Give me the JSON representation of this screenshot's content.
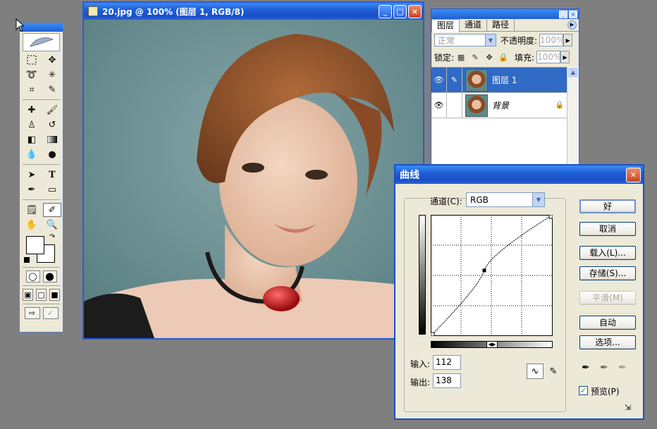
{
  "image_window": {
    "title": "20.jpg @ 100% (图层 1, RGB/8)",
    "buttons": [
      "_",
      "□",
      "×"
    ]
  },
  "layers_panel": {
    "tabs": [
      "图层",
      "通道",
      "路径"
    ],
    "blend_mode": "正常",
    "opacity_label": "不透明度:",
    "opacity_value": "100%",
    "lock_label": "锁定:",
    "fill_label": "填充:",
    "fill_value": "100%",
    "layers": [
      {
        "name": "图层 1",
        "selected": true
      },
      {
        "name": "背景",
        "selected": false,
        "locked": true
      }
    ]
  },
  "curves_dialog": {
    "title": "曲线",
    "channel_label": "通道(C):",
    "channel_value": "RGB",
    "input_label": "输入:",
    "input_value": "112",
    "output_label": "输出:",
    "output_value": "138",
    "buttons": {
      "ok": "好",
      "cancel": "取消",
      "load": "载入(L)...",
      "save": "存储(S)...",
      "smooth": "平滑(M)",
      "auto": "自动",
      "options": "选项..."
    },
    "preview_label": "预览(P)",
    "preview_checked": true,
    "curve_point": {
      "input": 112,
      "output": 138
    }
  }
}
